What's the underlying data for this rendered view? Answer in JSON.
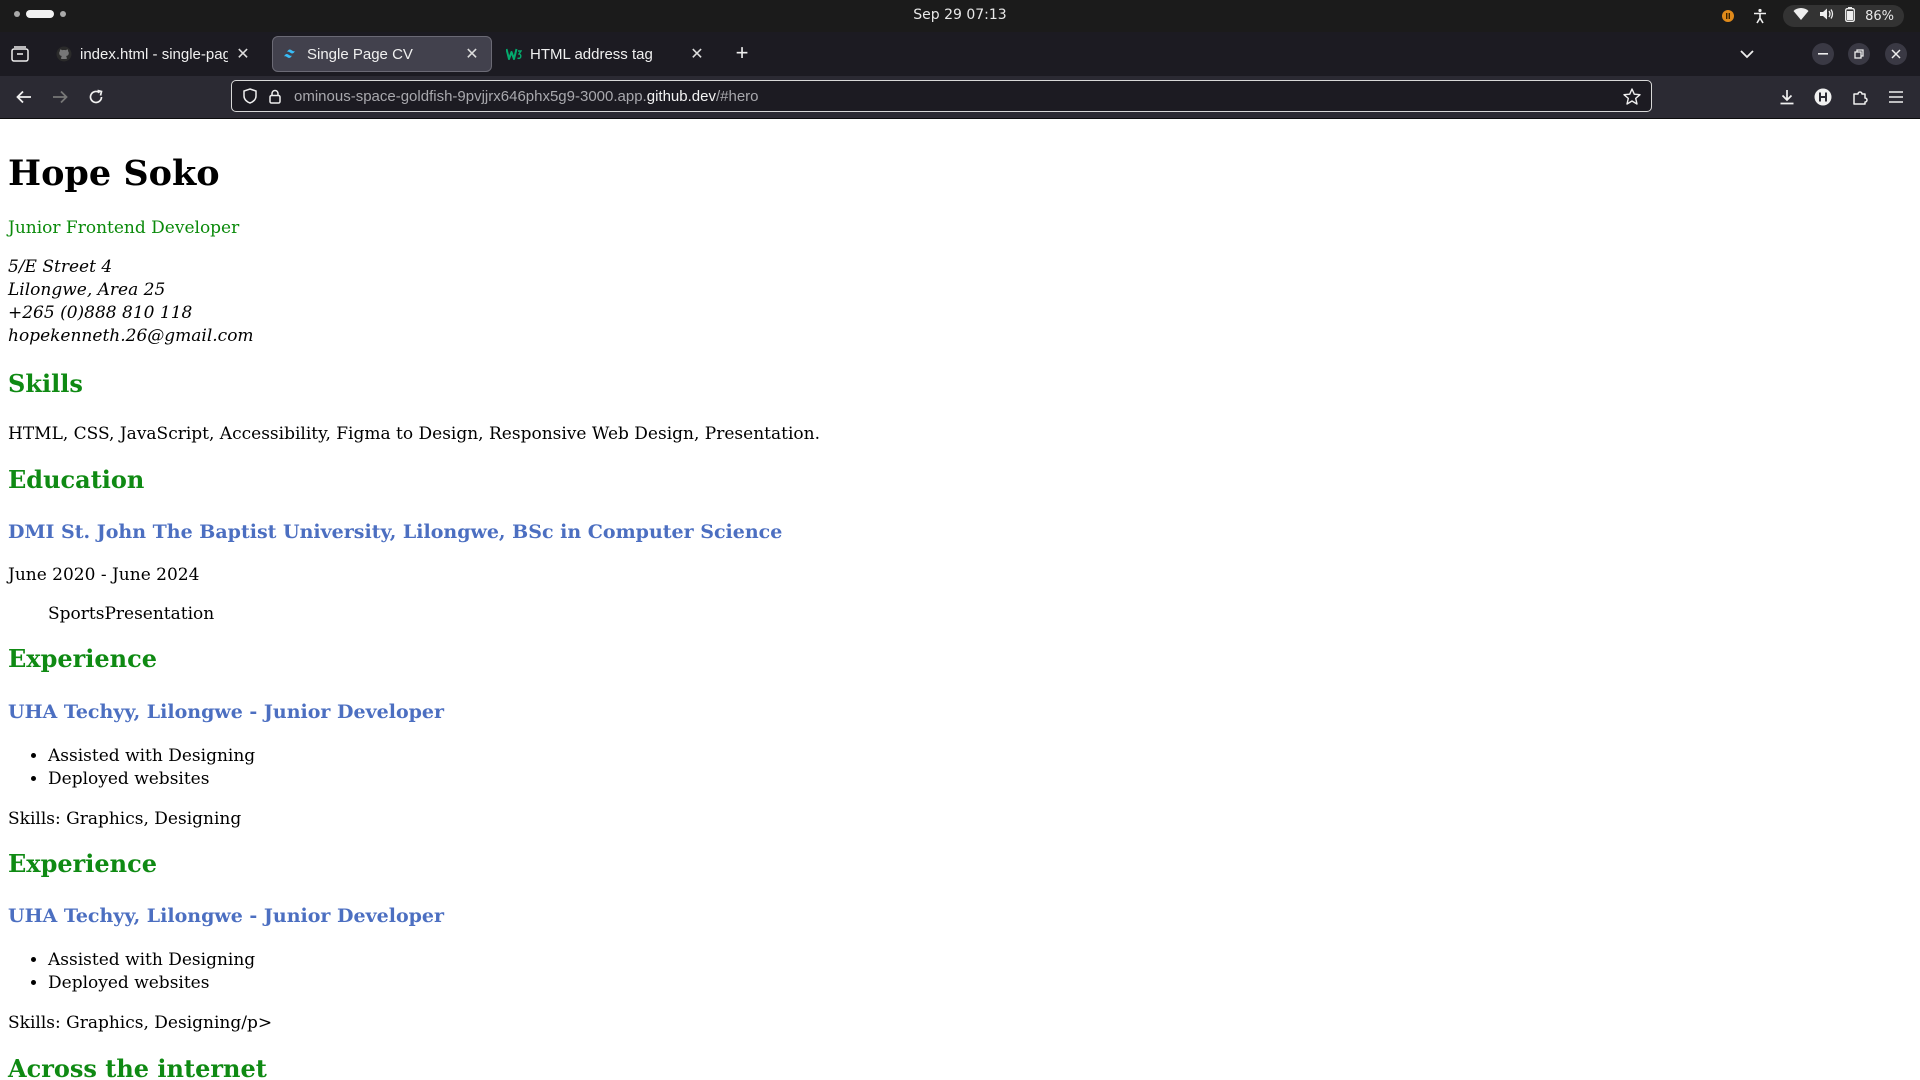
{
  "system": {
    "datetime": "Sep 29  07:13",
    "battery": "86%"
  },
  "browser": {
    "tabs": [
      {
        "title": "index.html - single-page-l",
        "icon": "github-icon",
        "active": false
      },
      {
        "title": "Single Page CV",
        "icon": "tailwind-icon",
        "active": true
      },
      {
        "title": "HTML address tag",
        "icon": "w3schools-icon",
        "active": false
      }
    ],
    "url": {
      "prefix": "ominous-space-goldfish-9pvjjrx646phx5g9-3000.app.",
      "host": "github.dev",
      "suffix": "/#hero"
    }
  },
  "cv": {
    "name": "Hope Soko",
    "role": "Junior Frontend Developer",
    "address": {
      "line1": "5/E Street 4",
      "line2": "Lilongwe, Area 25",
      "phone": "+265 (0)888 810 118",
      "email": "hopekenneth.26@gmail.com"
    },
    "skills": {
      "heading": "Skills",
      "text": "HTML, CSS, JavaScript, Accessibility, Figma to Design, Responsive Web Design, Presentation."
    },
    "education": {
      "heading": "Education",
      "school": "DMI St. John The Baptist University, Lilongwe, BSc in Computer Science",
      "dates": "June 2020 - June 2024",
      "activities": "SportsPresentation"
    },
    "experience": [
      {
        "heading": "Experience",
        "job": "UHA Techyy, Lilongwe - Junior Developer",
        "bullets": [
          "Assisted with Designing",
          "Deployed websites"
        ],
        "skills": "Skills: Graphics, Designing"
      },
      {
        "heading": "Experience",
        "job": "UHA Techyy, Lilongwe - Junior Developer",
        "bullets": [
          "Assisted with Designing",
          "Deployed websites"
        ],
        "skills": "Skills: Graphics, Designing/p>"
      }
    ],
    "internet": {
      "heading": "Across the internet"
    }
  },
  "colors": {
    "heading_green": "#0f8a13",
    "role_green": "#0a8a0a",
    "subheading_blue": "#4c6fc1",
    "tab_active_bg": "#42414d",
    "toolbar_bg": "#2b2a33"
  }
}
